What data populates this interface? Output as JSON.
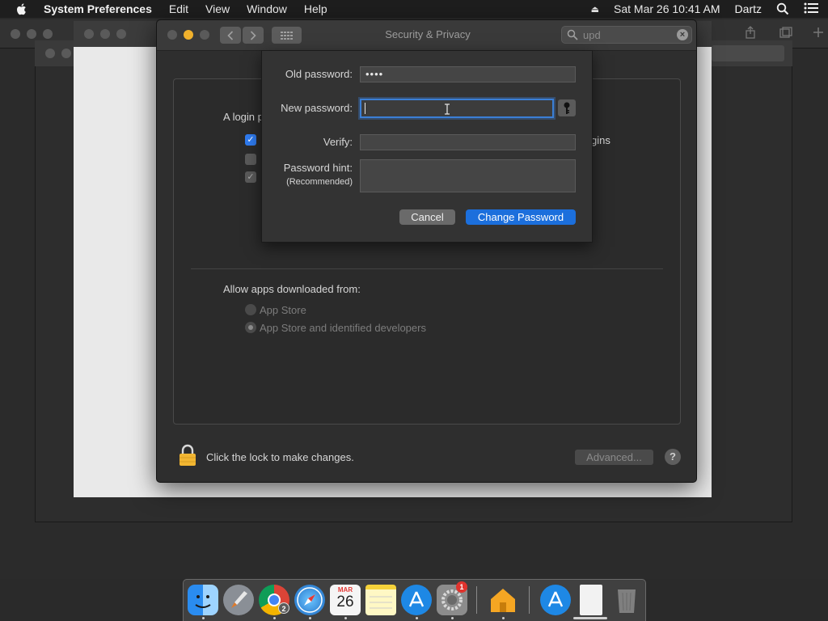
{
  "menubar": {
    "app_name": "System Preferences",
    "items": [
      "Edit",
      "View",
      "Window",
      "Help"
    ],
    "datetime": "Sat Mar 26  10:41 AM",
    "user": "Dartz",
    "apple_icon": "apple-icon",
    "eject_icon": "eject-icon",
    "search_icon": "spotlight-search-icon",
    "menu_icon": "notification-center-icon"
  },
  "window": {
    "title": "Security & Privacy",
    "search": {
      "value": "upd"
    },
    "login_label": "A login p",
    "checkbox_tail_text": "gins",
    "allow_label": "Allow apps downloaded from:",
    "radio_options": [
      "App Store",
      "App Store and identified developers"
    ],
    "radio_selected": "App Store and identified developers",
    "lock_text": "Click the lock to make changes.",
    "advanced_label": "Advanced...",
    "help_label": "?"
  },
  "sheet": {
    "old_password_label": "Old password:",
    "old_password_value": "••••",
    "new_password_label": "New password:",
    "new_password_value": "",
    "verify_label": "Verify:",
    "verify_value": "",
    "hint_label": "Password hint:",
    "hint_sublabel": "(Recommended)",
    "hint_value": "",
    "cancel_label": "Cancel",
    "change_label": "Change Password"
  },
  "dock": {
    "apps": [
      "Finder",
      "Launchpad",
      "Google Chrome",
      "Safari",
      "Calendar",
      "Notes",
      "App Store",
      "System Preferences",
      "Home",
      "Applications",
      "Documents",
      "Trash"
    ],
    "chrome_badge": "2",
    "sysprefs_badge": "1",
    "calendar_month": "MAR",
    "calendar_day": "26"
  },
  "colors": {
    "accent": "#1c6fdc",
    "focus_ring": "#3b7fd6",
    "badge": "#e0332d"
  }
}
